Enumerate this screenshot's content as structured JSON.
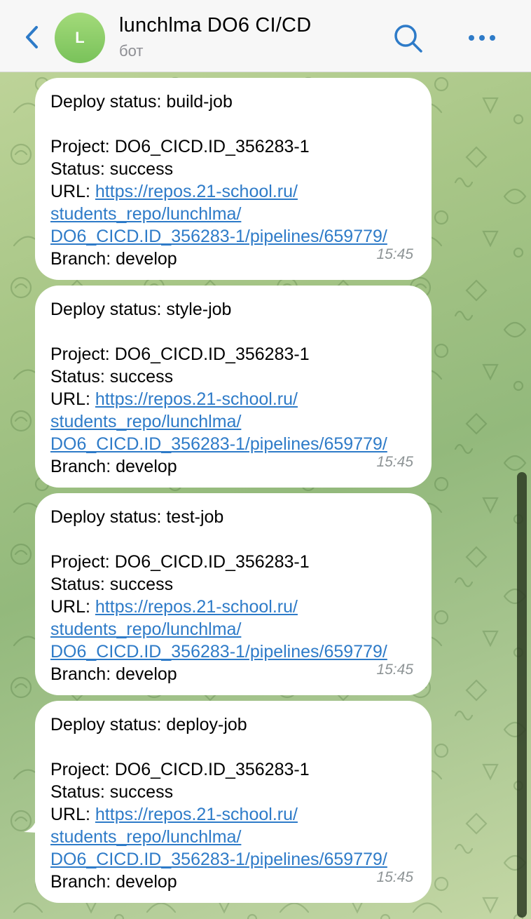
{
  "header": {
    "back_icon": "chevron-left-icon",
    "avatar_letter": "L",
    "title": "lunchlma DO6 CI/CD",
    "subtitle": "бот",
    "search_icon": "search-icon",
    "more_icon": "more-dots-icon",
    "accent_color": "#2e7bc8"
  },
  "messages": [
    {
      "heading": "Deploy status: build-job",
      "project": "Project: DO6_CICD.ID_356283-1",
      "status": "Status: success",
      "url_label": "URL: ",
      "url_lines": [
        "https://repos.21-school.ru/",
        "students_repo/lunchlma/",
        "DO6_CICD.ID_356283-1/pipelines/659779/"
      ],
      "branch": "Branch: develop",
      "time": "15:45"
    },
    {
      "heading": "Deploy status: style-job",
      "project": "Project: DO6_CICD.ID_356283-1",
      "status": "Status: success",
      "url_label": "URL: ",
      "url_lines": [
        "https://repos.21-school.ru/",
        "students_repo/lunchlma/",
        "DO6_CICD.ID_356283-1/pipelines/659779/"
      ],
      "branch": "Branch: develop",
      "time": "15:45"
    },
    {
      "heading": "Deploy status: test-job",
      "project": "Project: DO6_CICD.ID_356283-1",
      "status": "Status: success",
      "url_label": "URL: ",
      "url_lines": [
        "https://repos.21-school.ru/",
        "students_repo/lunchlma/",
        "DO6_CICD.ID_356283-1/pipelines/659779/"
      ],
      "branch": "Branch: develop",
      "time": "15:45"
    },
    {
      "heading": "Deploy status: deploy-job",
      "project": "Project: DO6_CICD.ID_356283-1",
      "status": "Status: success",
      "url_label": "URL: ",
      "url_lines": [
        "https://repos.21-school.ru/",
        "students_repo/lunchlma/",
        "DO6_CICD.ID_356283-1/pipelines/659779/"
      ],
      "branch": "Branch: develop",
      "time": "15:45"
    }
  ]
}
